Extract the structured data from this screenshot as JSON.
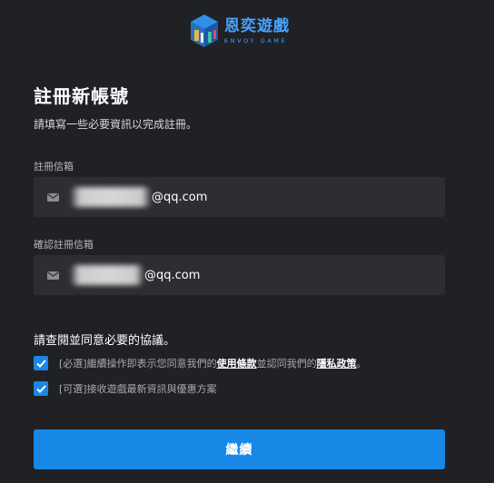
{
  "brand": {
    "name_cn": "恩奕遊戲",
    "name_en": "ENVOY GAME",
    "accent": "#4aa3ff"
  },
  "page": {
    "title": "註冊新帳號",
    "subtitle": "請填寫一些必要資訊以完成註冊。"
  },
  "form": {
    "email": {
      "label": "註冊信箱",
      "icon": "mail-icon",
      "value_suffix": "@qq.com"
    },
    "confirm_email": {
      "label": "確認註冊信箱",
      "icon": "mail-icon",
      "value_suffix": "@qq.com"
    }
  },
  "agreements": {
    "title": "請查閱並同意必要的協議。",
    "required": {
      "checked": true,
      "tag": "[必選]",
      "text_before": " 繼續操作即表示您同意我們的",
      "terms_link": "使用條款",
      "text_middle": "並認同我們的",
      "privacy_link": "隱私政策",
      "text_after": "。"
    },
    "optional": {
      "checked": true,
      "tag": "[可選]",
      "text": " 接收遊戲最新資訊與優惠方案"
    }
  },
  "submit": {
    "label": "繼續",
    "color": "#1788e6"
  }
}
